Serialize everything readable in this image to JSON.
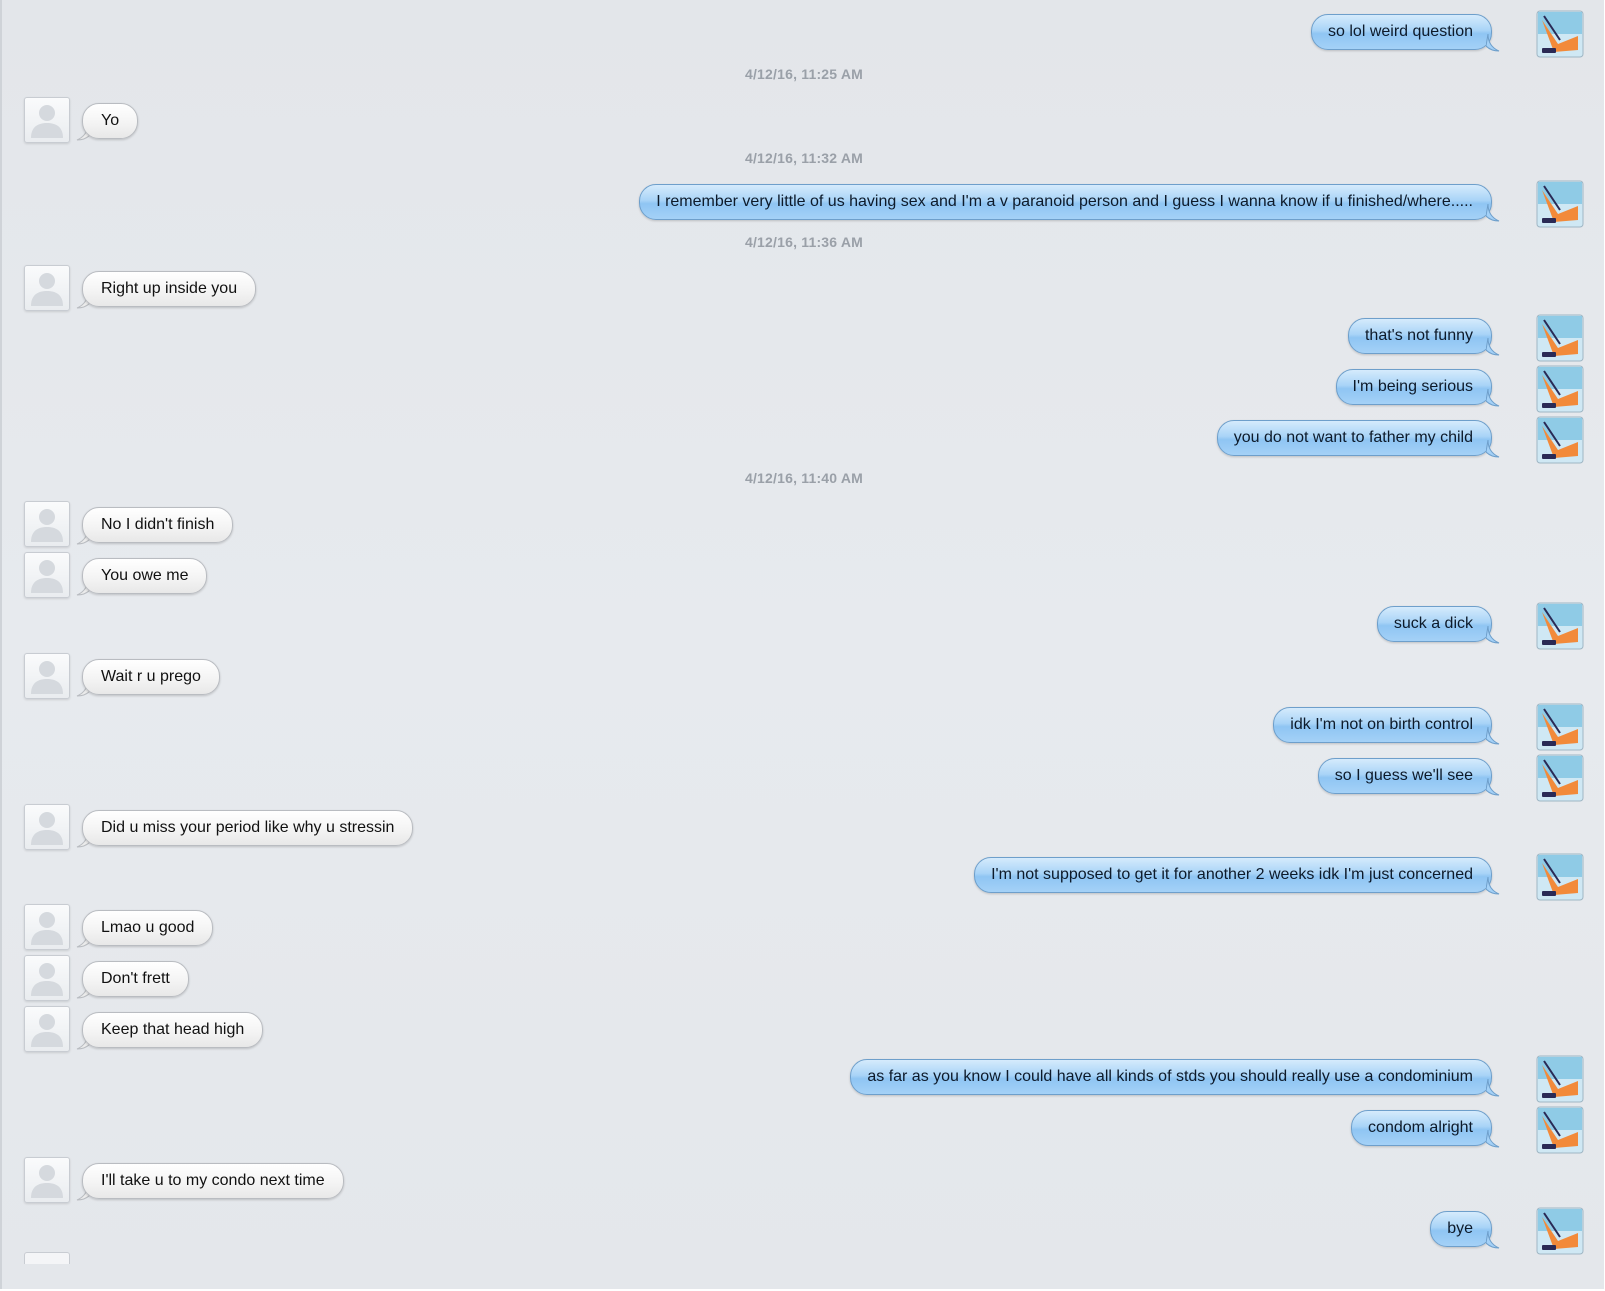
{
  "colors": {
    "background": "#e5e8ec",
    "sent_bubble": "#a9d4f7",
    "received_bubble": "#f4f4f4",
    "timestamp_text": "#9aa0a8"
  },
  "icons": {
    "received_avatar": "person-silhouette-icon",
    "sent_avatar": "orange-photo-avatar-icon"
  },
  "messages": [
    {
      "type": "sent",
      "text": "so lol weird question"
    },
    {
      "type": "timestamp",
      "text": "4/12/16, 11:25 AM"
    },
    {
      "type": "received",
      "text": "Yo"
    },
    {
      "type": "timestamp",
      "text": "4/12/16, 11:32 AM"
    },
    {
      "type": "sent",
      "text": "I remember very little of us having sex and I'm a v paranoid person and I guess I wanna know if u finished/where....."
    },
    {
      "type": "timestamp",
      "text": "4/12/16, 11:36 AM"
    },
    {
      "type": "received",
      "text": "Right up inside you"
    },
    {
      "type": "sent",
      "text": "that's not funny"
    },
    {
      "type": "sent",
      "text": "I'm being serious"
    },
    {
      "type": "sent",
      "text": "you do not want to father my child"
    },
    {
      "type": "timestamp",
      "text": "4/12/16, 11:40 AM"
    },
    {
      "type": "received",
      "text": "No I didn't finish"
    },
    {
      "type": "received",
      "text": "You owe me"
    },
    {
      "type": "sent",
      "text": "suck a dick"
    },
    {
      "type": "received",
      "text": "Wait r u prego"
    },
    {
      "type": "sent",
      "text": "idk I'm not on birth control"
    },
    {
      "type": "sent",
      "text": "so I guess we'll see"
    },
    {
      "type": "received",
      "text": "Did u miss your period like why u stressin"
    },
    {
      "type": "sent",
      "text": "I'm not supposed to get it for another 2 weeks idk I'm just concerned"
    },
    {
      "type": "received",
      "text": "Lmao u good"
    },
    {
      "type": "received",
      "text": "Don't frett"
    },
    {
      "type": "received",
      "text": "Keep that head high"
    },
    {
      "type": "sent",
      "text": "as far as you know I could have all kinds of stds you should really use a condominium"
    },
    {
      "type": "sent",
      "text": "condom alright"
    },
    {
      "type": "received",
      "text": "I'll take u to my condo next time"
    },
    {
      "type": "sent",
      "text": "bye"
    }
  ]
}
